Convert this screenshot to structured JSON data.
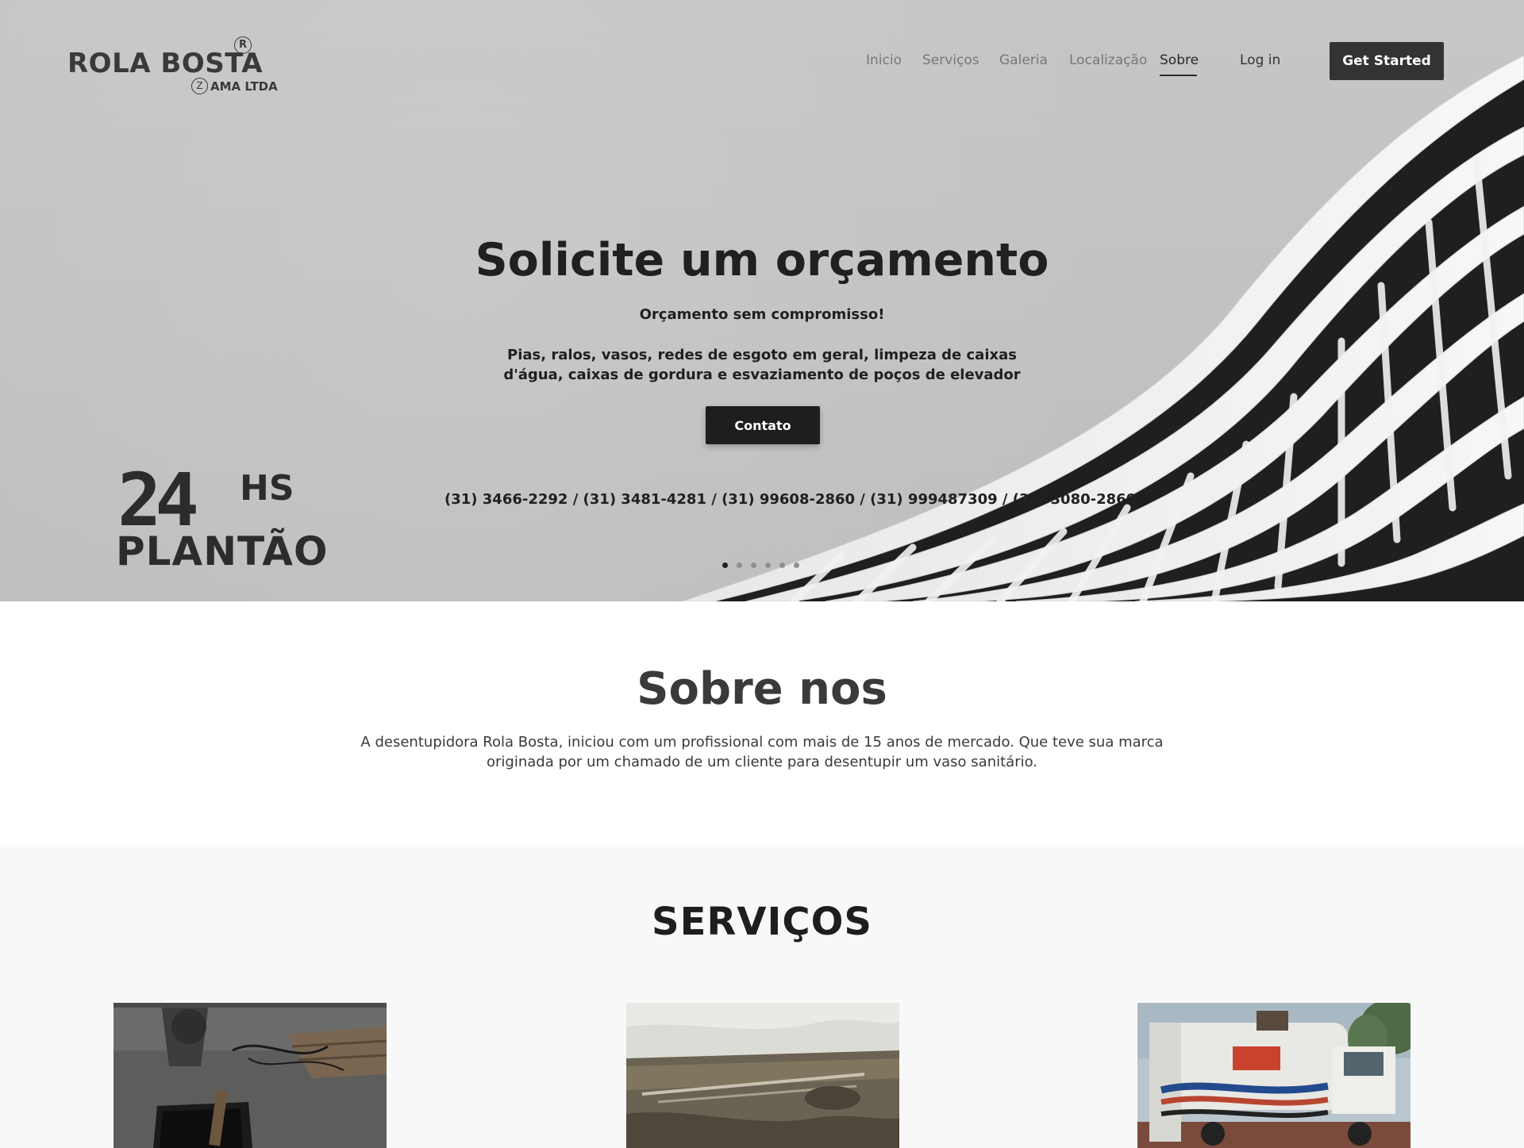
{
  "logo": {
    "title": "ROLA BOSTA",
    "registered_mark": "R",
    "z_mark": "Z",
    "subtitle": "AMA LTDA"
  },
  "nav": {
    "items": [
      {
        "label": "Inicio"
      },
      {
        "label": "Serviços"
      },
      {
        "label": "Galeria"
      },
      {
        "label": "Localização"
      },
      {
        "label": "Sobre",
        "active": true
      }
    ],
    "login_label": "Log in",
    "cta_label": "Get Started"
  },
  "hero": {
    "title": "Solicite um orçamento",
    "subtitle": "Orçamento sem compromisso!",
    "description": "Pias, ralos, vasos, redes de esgoto em geral, limpeza de caixas d'água, caixas de gordura e esvaziamento de poços de elevador",
    "button_label": "Contato",
    "phones": "(31) 3466-2292 / (31) 3481-4281 / (31) 99608-2860 / (31) 999487309 / (31) 3080-2860",
    "slides_total": 6,
    "slide_active": 1,
    "badge_number": "24",
    "badge_unit": "HS",
    "badge_label": "PLANTÃO"
  },
  "about": {
    "title": "Sobre nos",
    "text": "A desentupidora Rola Bosta, iniciou com um profissional com mais de 15 anos de mercado. Que teve sua marca originada por um chamado de um cliente para desentupir um vaso sanitário."
  },
  "services": {
    "title": "SERVIÇOS",
    "images": [
      {
        "alt": "service-photo-1"
      },
      {
        "alt": "service-photo-2"
      },
      {
        "alt": "service-photo-3"
      }
    ]
  },
  "colors": {
    "hero_bg": "#c2c2c2",
    "dark_button": "#333333",
    "contact_button": "#1e1e1e",
    "text_dark": "#202020",
    "services_bg": "#f8f8f8"
  }
}
